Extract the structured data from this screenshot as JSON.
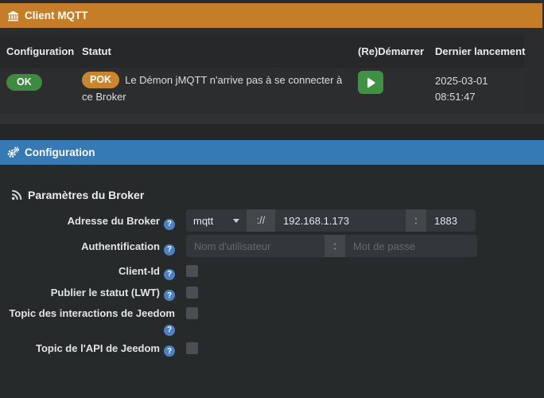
{
  "icons": {
    "help_glyph": "?"
  },
  "theme": {
    "header_orange": "#c67d27",
    "header_blue": "#3579b5",
    "badge_ok_green": "#3d8b40",
    "badge_pok_orange": "#c9862f",
    "play_button_green": "#3f9244",
    "help_icon_blue": "#4c82c3"
  },
  "client_panel": {
    "title": "Client MQTT",
    "columns": [
      "Configuration",
      "Statut",
      "(Re)Démarrer",
      "Dernier lancement"
    ],
    "row": {
      "config_status": "OK",
      "daemon_status": "POK",
      "status_message": "Le Démon jMQTT n'arrive pas à se connecter à ce Broker",
      "last_launch_date": "2025-03-01",
      "last_launch_time": "08:51:47"
    }
  },
  "configuration": {
    "title": "Configuration",
    "broker_section_title": "Paramètres du Broker",
    "address": {
      "label": "Adresse du Broker",
      "protocol": "mqtt",
      "separator": "://",
      "host": "192.168.1.173",
      "port_separator": ":",
      "port": "1883"
    },
    "auth": {
      "label": "Authentification",
      "username_placeholder": "Nom d'utilisateur",
      "separator": ":",
      "password_placeholder": "Mot de passe"
    },
    "client_id": {
      "label": "Client-Id"
    },
    "lwt": {
      "label": "Publier le statut (LWT)"
    },
    "interactions": {
      "label": "Topic des interactions de Jeedom"
    },
    "api": {
      "label": "Topic de l'API de Jeedom"
    }
  }
}
